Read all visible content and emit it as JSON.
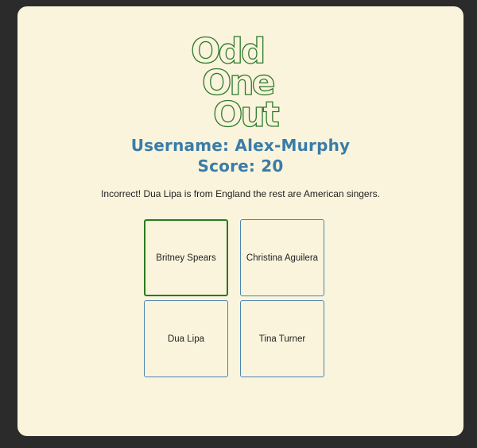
{
  "logo": {
    "line1": "Odd",
    "line2": "One",
    "line3": "Out"
  },
  "player": {
    "username_label": "Username:",
    "username": "Alex-Murphy",
    "score_label": "Score:",
    "score": "20"
  },
  "feedback": {
    "verdict": "Incorrect!",
    "message": "Dua Lipa is from England the rest are American singers."
  },
  "options": [
    {
      "label": "Britney Spears",
      "state": "highlighted"
    },
    {
      "label": "Christina Aguilera",
      "state": "normal"
    },
    {
      "label": "Dua Lipa",
      "state": "normal"
    },
    {
      "label": "Tina Turner",
      "state": "normal"
    }
  ],
  "colors": {
    "background": "#faf4dc",
    "frame": "#2b2b2b",
    "accent_blue": "#3a7ca8",
    "logo_green": "#2e7a2e",
    "highlight_green": "#2a7a1e"
  }
}
